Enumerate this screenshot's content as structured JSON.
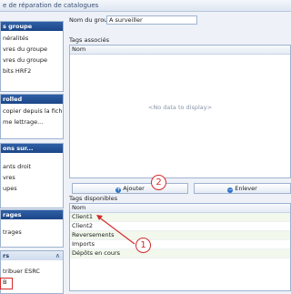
{
  "window": {
    "title": "e de réparation de catalogues"
  },
  "sidebar": {
    "groupe": {
      "title": "s groupe",
      "items": [
        "néralités",
        "vres du groupe",
        "vres du groupe",
        "bits HRF2"
      ]
    },
    "rolled": {
      "title": "rolled",
      "items": [
        "copier depuis la fiche AD",
        "me lettrage..."
      ]
    },
    "sur": {
      "title": "ons sur...",
      "items": [
        "ants droit",
        "vres",
        "upes"
      ]
    },
    "rages": {
      "title": "rages",
      "items": [
        "trages"
      ]
    },
    "rs": {
      "title": "rs",
      "items": [
        "tribuer ESRC",
        "B"
      ]
    }
  },
  "main": {
    "group_label": "Nom du groupe",
    "group_value": "A surveiller",
    "associated_label": "Tags associés",
    "column_header": "Nom",
    "no_data": "<No data to display>",
    "add_button": "Ajouter",
    "remove_button": "Enlever",
    "available_label": "Tags disponibles",
    "available_column_header": "Nom",
    "available_rows": [
      "Client1",
      "Client2",
      "Reversements",
      "Imports",
      "Dépôts en cours"
    ]
  },
  "annotations": {
    "badge1": "1",
    "badge2": "2"
  },
  "colors": {
    "header_blue": "#1c4687",
    "annotation_red": "#d42b2b"
  }
}
